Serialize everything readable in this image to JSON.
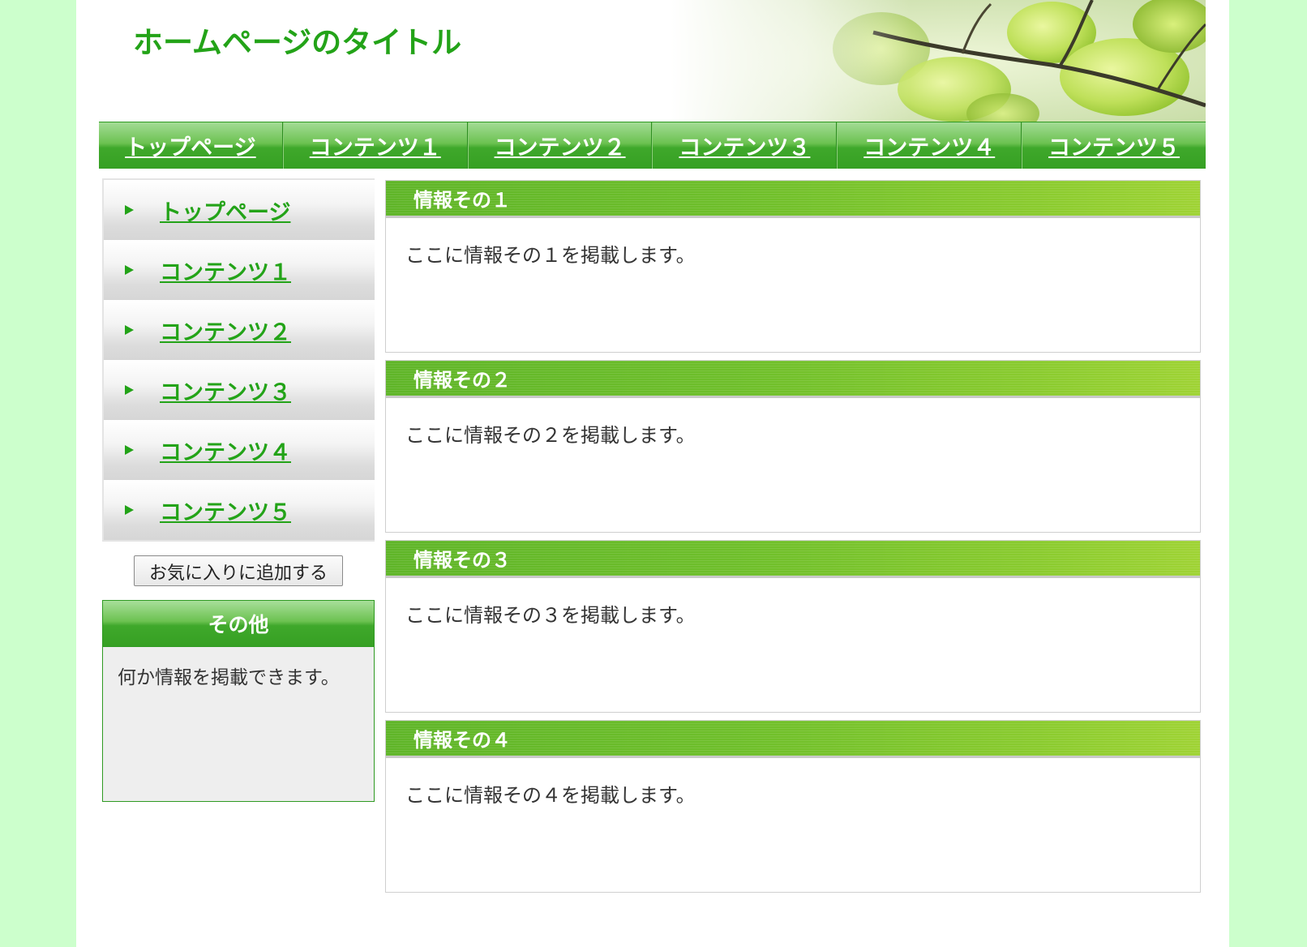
{
  "header": {
    "site_title": "ホームページのタイトル"
  },
  "topnav": {
    "items": [
      {
        "label": "トップページ"
      },
      {
        "label": "コンテンツ１"
      },
      {
        "label": "コンテンツ２"
      },
      {
        "label": "コンテンツ３"
      },
      {
        "label": "コンテンツ４"
      },
      {
        "label": "コンテンツ５"
      }
    ]
  },
  "sidebar": {
    "items": [
      {
        "label": "トップページ"
      },
      {
        "label": "コンテンツ１"
      },
      {
        "label": "コンテンツ２"
      },
      {
        "label": "コンテンツ３"
      },
      {
        "label": "コンテンツ４"
      },
      {
        "label": "コンテンツ５"
      }
    ],
    "favorite_button": "お気に入りに追加する",
    "other": {
      "title": "その他",
      "body": "何か情報を掲載できます。"
    }
  },
  "main": {
    "sections": [
      {
        "title": "情報その１",
        "body": "ここに情報その１を掲載します。"
      },
      {
        "title": "情報その２",
        "body": "ここに情報その２を掲載します。"
      },
      {
        "title": "情報その３",
        "body": "ここに情報その３を掲載します。"
      },
      {
        "title": "情報その４",
        "body": "ここに情報その４を掲載します。"
      }
    ]
  },
  "colors": {
    "page_background": "#ccffcc",
    "brand_green": "#23a318",
    "nav_green": "#3fa82b",
    "section_header_green": "#6fbf2a"
  },
  "icons": {
    "side_menu_marker": "triangle-right-icon",
    "header_image": "leaves-photo"
  }
}
